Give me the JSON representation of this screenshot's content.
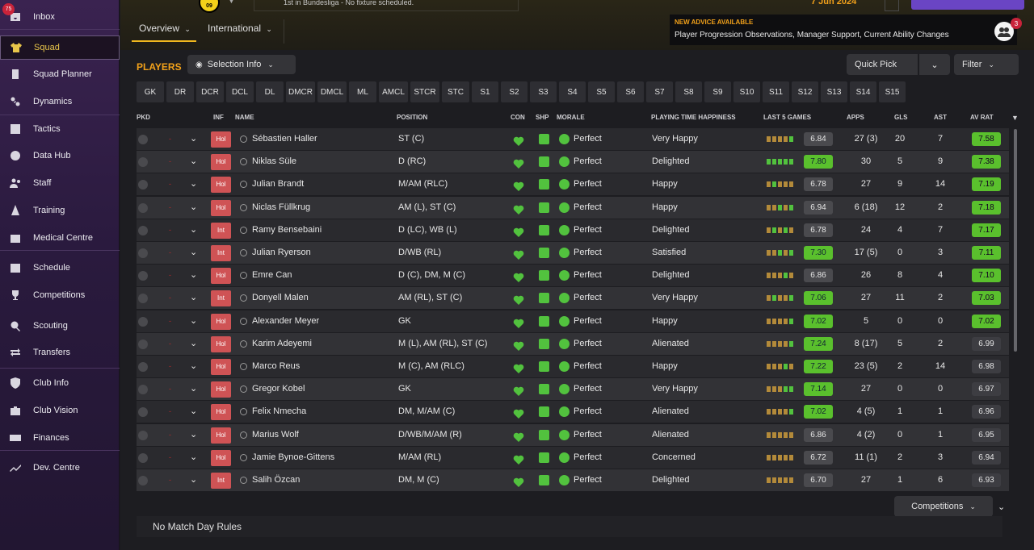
{
  "app": {
    "date": "7 Jun 2024",
    "fixture_text": "1st in Bundesliga - No fixture scheduled.",
    "inbox_badge": "75",
    "crest_text": "09"
  },
  "sidebar": {
    "items": [
      {
        "label": "Inbox",
        "icon": "inbox-icon"
      },
      {
        "label": "Squad",
        "icon": "shirt-icon"
      },
      {
        "label": "Squad Planner",
        "icon": "clipboard-icon"
      },
      {
        "label": "Dynamics",
        "icon": "dynamics-icon"
      },
      {
        "label": "Tactics",
        "icon": "tactics-board-icon"
      },
      {
        "label": "Data Hub",
        "icon": "data-hub-icon"
      },
      {
        "label": "Staff",
        "icon": "staff-icon"
      },
      {
        "label": "Training",
        "icon": "training-cone-icon"
      },
      {
        "label": "Medical Centre",
        "icon": "medical-kit-icon"
      },
      {
        "label": "Schedule",
        "icon": "calendar-icon"
      },
      {
        "label": "Competitions",
        "icon": "trophy-icon"
      },
      {
        "label": "Scouting",
        "icon": "magnifier-icon"
      },
      {
        "label": "Transfers",
        "icon": "transfer-arrows-icon"
      },
      {
        "label": "Club Info",
        "icon": "shield-icon"
      },
      {
        "label": "Club Vision",
        "icon": "briefcase-icon"
      },
      {
        "label": "Finances",
        "icon": "money-icon"
      },
      {
        "label": "Dev. Centre",
        "icon": "trend-icon"
      }
    ]
  },
  "tabs": [
    {
      "label": "Overview"
    },
    {
      "label": "International"
    }
  ],
  "advice": {
    "title": "NEW ADVICE AVAILABLE",
    "text": "Player Progression Observations, Manager Support, Current Ability Changes",
    "badge": "3"
  },
  "toolbar": {
    "players": "PLAYERS",
    "selection_info": "Selection Info",
    "quick_pick": "Quick Pick",
    "filter": "Filter"
  },
  "positions": [
    "GK",
    "DR",
    "DCR",
    "DCL",
    "DL",
    "DMCR",
    "DMCL",
    "ML",
    "AMCL",
    "STCR",
    "STC",
    "S1",
    "S2",
    "S3",
    "S4",
    "S5",
    "S6",
    "S7",
    "S8",
    "S9",
    "S10",
    "S11",
    "S12",
    "S13",
    "S14",
    "S15"
  ],
  "columns": {
    "pkd": "PKD",
    "inf": "INF",
    "name": "NAME",
    "position": "POSITION",
    "con": "CON",
    "shp": "SHP",
    "morale": "MORALE",
    "happiness": "PLAYING TIME HAPPINESS",
    "last5": "LAST 5 GAMES",
    "apps": "APPS",
    "gls": "GLS",
    "ast": "AST",
    "avrat": "AV RAT"
  },
  "colors": {
    "accent": "#f2a11a",
    "good": "#52c23e",
    "rating_high": "#5ac02d",
    "inf_badge": "#cf5355"
  },
  "players": [
    {
      "inf": "Hol",
      "name": "Sébastien Haller",
      "position": "ST (C)",
      "morale": "Perfect",
      "happiness": "Very Happy",
      "last5": "6.84",
      "apps": "27 (3)",
      "gls": "20",
      "ast": "7",
      "avrat": "7.58",
      "form": [
        0,
        0,
        0,
        0,
        1
      ]
    },
    {
      "inf": "Hol",
      "name": "Niklas Süle",
      "position": "D (RC)",
      "morale": "Perfect",
      "happiness": "Delighted",
      "last5": "7.80",
      "apps": "30",
      "gls": "5",
      "ast": "9",
      "avrat": "7.38",
      "form": [
        1,
        1,
        1,
        1,
        1
      ]
    },
    {
      "inf": "Hol",
      "name": "Julian Brandt",
      "position": "M/AM (RLC)",
      "morale": "Perfect",
      "happiness": "Happy",
      "last5": "6.78",
      "apps": "27",
      "gls": "9",
      "ast": "14",
      "avrat": "7.19",
      "form": [
        0,
        1,
        0,
        0,
        0
      ]
    },
    {
      "inf": "Hol",
      "name": "Niclas Füllkrug",
      "position": "AM (L), ST (C)",
      "morale": "Perfect",
      "happiness": "Happy",
      "last5": "6.94",
      "apps": "6 (18)",
      "gls": "12",
      "ast": "2",
      "avrat": "7.18",
      "form": [
        0,
        0,
        1,
        0,
        1
      ]
    },
    {
      "inf": "Int",
      "name": "Ramy Bensebaini",
      "position": "D (LC), WB (L)",
      "morale": "Perfect",
      "happiness": "Delighted",
      "last5": "6.78",
      "apps": "24",
      "gls": "4",
      "ast": "7",
      "avrat": "7.17",
      "form": [
        0,
        1,
        0,
        1,
        0
      ]
    },
    {
      "inf": "Int",
      "name": "Julian Ryerson",
      "position": "D/WB (RL)",
      "morale": "Perfect",
      "happiness": "Satisfied",
      "last5": "7.30",
      "apps": "17 (5)",
      "gls": "0",
      "ast": "3",
      "avrat": "7.11",
      "form": [
        0,
        0,
        1,
        0,
        1
      ]
    },
    {
      "inf": "Hol",
      "name": "Emre Can",
      "position": "D (C), DM, M (C)",
      "morale": "Perfect",
      "happiness": "Delighted",
      "last5": "6.86",
      "apps": "26",
      "gls": "8",
      "ast": "4",
      "avrat": "7.10",
      "form": [
        0,
        0,
        0,
        1,
        0
      ]
    },
    {
      "inf": "Int",
      "name": "Donyell Malen",
      "position": "AM (RL), ST (C)",
      "morale": "Perfect",
      "happiness": "Very Happy",
      "last5": "7.06",
      "apps": "27",
      "gls": "11",
      "ast": "2",
      "avrat": "7.03",
      "form": [
        0,
        1,
        0,
        0,
        1
      ]
    },
    {
      "inf": "Hol",
      "name": "Alexander Meyer",
      "position": "GK",
      "morale": "Perfect",
      "happiness": "Happy",
      "last5": "7.02",
      "apps": "5",
      "gls": "0",
      "ast": "0",
      "avrat": "7.02",
      "form": [
        0,
        0,
        0,
        0,
        1
      ]
    },
    {
      "inf": "Hol",
      "name": "Karim Adeyemi",
      "position": "M (L), AM (RL), ST (C)",
      "morale": "Perfect",
      "happiness": "Alienated",
      "last5": "7.24",
      "apps": "8 (17)",
      "gls": "5",
      "ast": "2",
      "avrat": "6.99",
      "form": [
        0,
        0,
        0,
        0,
        1
      ]
    },
    {
      "inf": "Hol",
      "name": "Marco Reus",
      "position": "M (C), AM (RLC)",
      "morale": "Perfect",
      "happiness": "Happy",
      "last5": "7.22",
      "apps": "23 (5)",
      "gls": "2",
      "ast": "14",
      "avrat": "6.98",
      "form": [
        0,
        0,
        0,
        1,
        0
      ]
    },
    {
      "inf": "Hol",
      "name": "Gregor Kobel",
      "position": "GK",
      "morale": "Perfect",
      "happiness": "Very Happy",
      "last5": "7.14",
      "apps": "27",
      "gls": "0",
      "ast": "0",
      "avrat": "6.97",
      "form": [
        0,
        0,
        0,
        1,
        1
      ]
    },
    {
      "inf": "Hol",
      "name": "Felix Nmecha",
      "position": "DM, M/AM (C)",
      "morale": "Perfect",
      "happiness": "Alienated",
      "last5": "7.02",
      "apps": "4 (5)",
      "gls": "1",
      "ast": "1",
      "avrat": "6.96",
      "form": [
        0,
        0,
        0,
        0,
        1
      ]
    },
    {
      "inf": "Hol",
      "name": "Marius Wolf",
      "position": "D/WB/M/AM (R)",
      "morale": "Perfect",
      "happiness": "Alienated",
      "last5": "6.86",
      "apps": "4 (2)",
      "gls": "0",
      "ast": "1",
      "avrat": "6.95",
      "form": [
        0,
        0,
        0,
        0,
        0
      ]
    },
    {
      "inf": "Hol",
      "name": "Jamie Bynoe-Gittens",
      "position": "M/AM (RL)",
      "morale": "Perfect",
      "happiness": "Concerned",
      "last5": "6.72",
      "apps": "11 (1)",
      "gls": "2",
      "ast": "3",
      "avrat": "6.94",
      "form": [
        0,
        0,
        0,
        0,
        0
      ]
    },
    {
      "inf": "Int",
      "name": "Salih Özcan",
      "position": "DM, M (C)",
      "morale": "Perfect",
      "happiness": "Delighted",
      "last5": "6.70",
      "apps": "27",
      "gls": "1",
      "ast": "6",
      "avrat": "6.93",
      "form": [
        0,
        0,
        0,
        0,
        0
      ]
    }
  ],
  "footer": {
    "competitions": "Competitions",
    "no_match": "No Match Day Rules"
  }
}
